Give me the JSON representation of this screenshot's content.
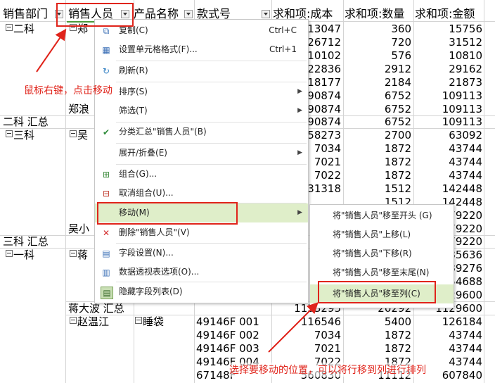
{
  "header": {
    "col1": "销售部门",
    "col2": "销售人员",
    "col3": "产品名称",
    "col4": "款式号",
    "col5": "求和项:成本",
    "col6": "求和项:数量",
    "col7": "求和项:金额"
  },
  "grid": {
    "dept_erke": "二科",
    "person_zhenglang_a": "郑",
    "person_zhenglang_b": "郑浪",
    "erke_total": "二科 汇总",
    "dept_sanke": "三科",
    "person_wu": "吴",
    "person_wu_b": "吴小",
    "sanke_total": "三科 汇总",
    "dept_yike": "一科",
    "person_jiang": "蒋",
    "jiang_total": "蒋大波 汇总",
    "person_zhao": "赵温江",
    "product_sleepingbag": "睡袋"
  },
  "rows": [
    {
      "cost": "13047",
      "qty": "360",
      "amt": "15756"
    },
    {
      "cost": "26712",
      "qty": "720",
      "amt": "31512"
    },
    {
      "cost": "10102",
      "qty": "576",
      "amt": "10810"
    },
    {
      "cost": "22836",
      "qty": "2912",
      "amt": "29162"
    },
    {
      "cost": "18177",
      "qty": "2184",
      "amt": "21873"
    },
    {
      "cost": "90874",
      "qty": "6752",
      "amt": "109113"
    },
    {
      "cost": "90874",
      "qty": "6752",
      "amt": "109113"
    },
    {
      "cost": "90874",
      "qty": "6752",
      "amt": "109113"
    },
    {
      "cost": "58273",
      "qty": "2700",
      "amt": "63092"
    },
    {
      "cost": "7034",
      "qty": "1872",
      "amt": "43744"
    },
    {
      "cost": "7021",
      "qty": "1872",
      "amt": "43744"
    },
    {
      "cost": "7022",
      "qty": "1872",
      "amt": "43744"
    },
    {
      "cost": "131318",
      "qty": "1512",
      "amt": "142448"
    },
    {
      "cost": "",
      "qty": "1512",
      "amt": "142448"
    },
    {
      "cost": "",
      "qty": "",
      "amt": "79220"
    },
    {
      "cost": "",
      "qty": "",
      "amt": "79220"
    },
    {
      "cost": "",
      "qty": "",
      "amt": "79220"
    },
    {
      "cost": "",
      "qty": "",
      "amt": "85636"
    },
    {
      "cost": "",
      "qty": "",
      "amt": "89276"
    },
    {
      "cost": "",
      "qty": "",
      "amt": "54688"
    },
    {
      "cost": "",
      "qty": "",
      "amt": "29600"
    },
    {
      "cost": "1133295",
      "qty": "20292",
      "amt": "1129600"
    },
    {
      "code": "49146F 001",
      "cost": "116546",
      "qty": "5400",
      "amt": "126184"
    },
    {
      "code": "49146F 002",
      "cost": "7034",
      "qty": "1872",
      "amt": "43744"
    },
    {
      "code": "49146F 003",
      "cost": "7021",
      "qty": "1872",
      "amt": "43744"
    },
    {
      "code": "49146F 004",
      "cost": "7022",
      "qty": "1872",
      "amt": "43744"
    },
    {
      "code": "67148F",
      "cost": "560830",
      "qty": "11112",
      "amt": "607840"
    }
  ],
  "context_menu": {
    "copy": "复制(C)",
    "copy_shortcut": "Ctrl+C",
    "format_cells": "设置单元格格式(F)...",
    "format_shortcut": "Ctrl+1",
    "refresh": "刷新(R)",
    "sort": "排序(S)",
    "filter": "筛选(T)",
    "subtotal": "分类汇总\"销售人员\"(B)",
    "expand_collapse": "展开/折叠(E)",
    "group": "组合(G)...",
    "ungroup": "取消组合(U)...",
    "move": "移动(M)",
    "delete": "删除\"销售人员\"(V)",
    "field_settings": "字段设置(N)...",
    "pivot_options": "数据透视表选项(O)...",
    "hide_field_list": "隐藏字段列表(D)"
  },
  "submenu": {
    "to_start": "将\"销售人员\"移至开头 (G)",
    "move_up": "将\"销售人员\"上移(L)",
    "move_down": "将\"销售人员\"下移(R)",
    "to_end": "将\"销售人员\"移至末尾(N)",
    "to_columns": "将\"销售人员\"移至列(C)"
  },
  "annotations": {
    "note1": "鼠标右键，点击移动",
    "note2": "选择要移动的位置，可以将行移到列进行排列"
  },
  "colors": {
    "annotation_red": "#e0241b",
    "menu_highlight": "#dfeec9",
    "selected_border": "#4a9a3a"
  },
  "icons": {
    "copy": "copy-icon",
    "format": "format-cells-icon",
    "refresh": "refresh-icon",
    "subtotal": "checkmark-icon",
    "group": "group-icon",
    "ungroup": "ungroup-icon",
    "delete": "delete-x-icon",
    "field_settings": "field-settings-icon",
    "pivot_options": "pivot-options-icon",
    "hide_field_list": "field-list-icon"
  }
}
